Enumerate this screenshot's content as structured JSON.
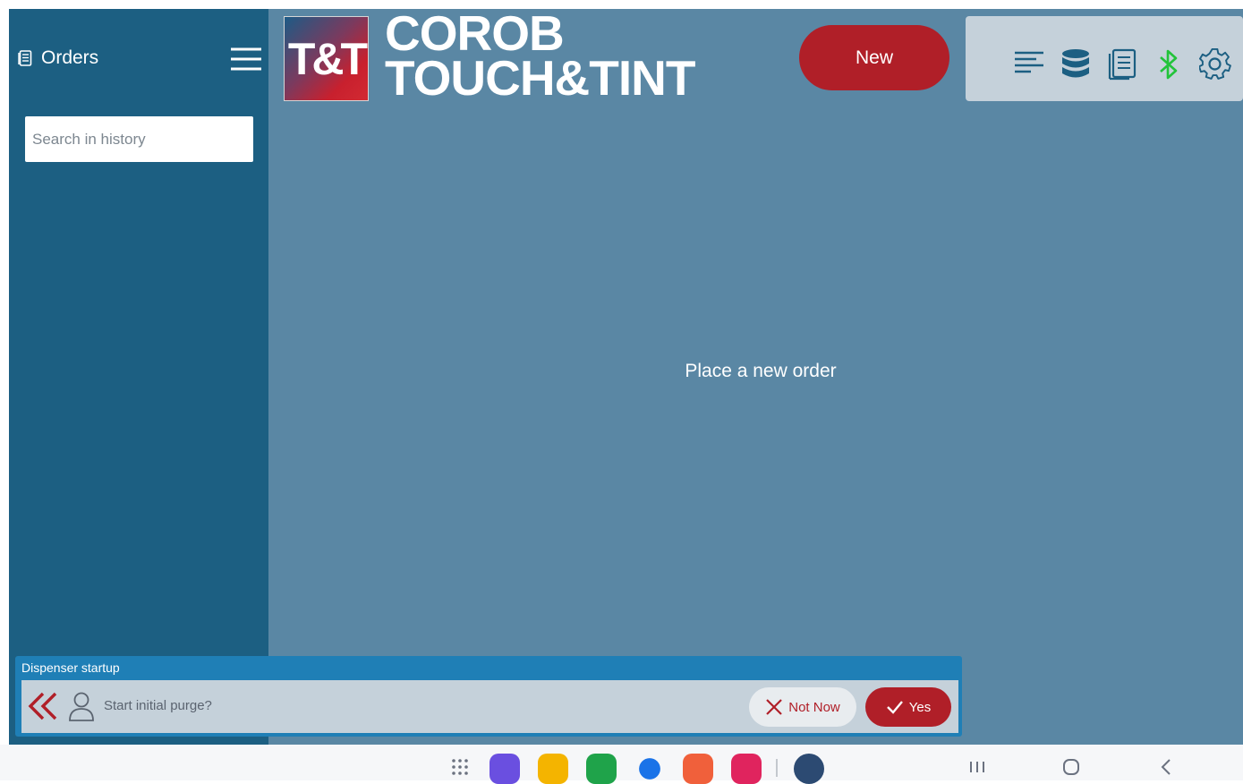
{
  "sidebar": {
    "title": "Orders",
    "search_placeholder": "Search in history"
  },
  "header": {
    "logo_text": "T&T",
    "brand_line1": "COROB",
    "brand_line2": "TOUCH&TINT",
    "new_button_label": "New",
    "toolbar_icons": [
      "list-icon",
      "database-icon",
      "document-icon",
      "bluetooth-icon",
      "gear-icon"
    ]
  },
  "main": {
    "empty_message": "Place a new order"
  },
  "notification": {
    "title": "Dispenser startup",
    "message": "Start initial purge?",
    "not_now_label": "Not Now",
    "yes_label": "Yes"
  },
  "taskbar": {
    "apps": [
      "app-drawer-icon",
      "internet-browser-icon",
      "my-files-icon",
      "phone-icon",
      "messages-icon",
      "contacts-icon",
      "screen-recorder-icon",
      "settings-icon"
    ],
    "nav": [
      "recents-icon",
      "home-icon",
      "back-icon"
    ]
  },
  "colors": {
    "sidebar": "#1c5f82",
    "main_bg": "#5a87a4",
    "accent_red": "#b01f28",
    "toolbar_bg": "#c5d1da",
    "bluetooth": "#22c33a",
    "notification_bar": "#1f7fb6"
  }
}
